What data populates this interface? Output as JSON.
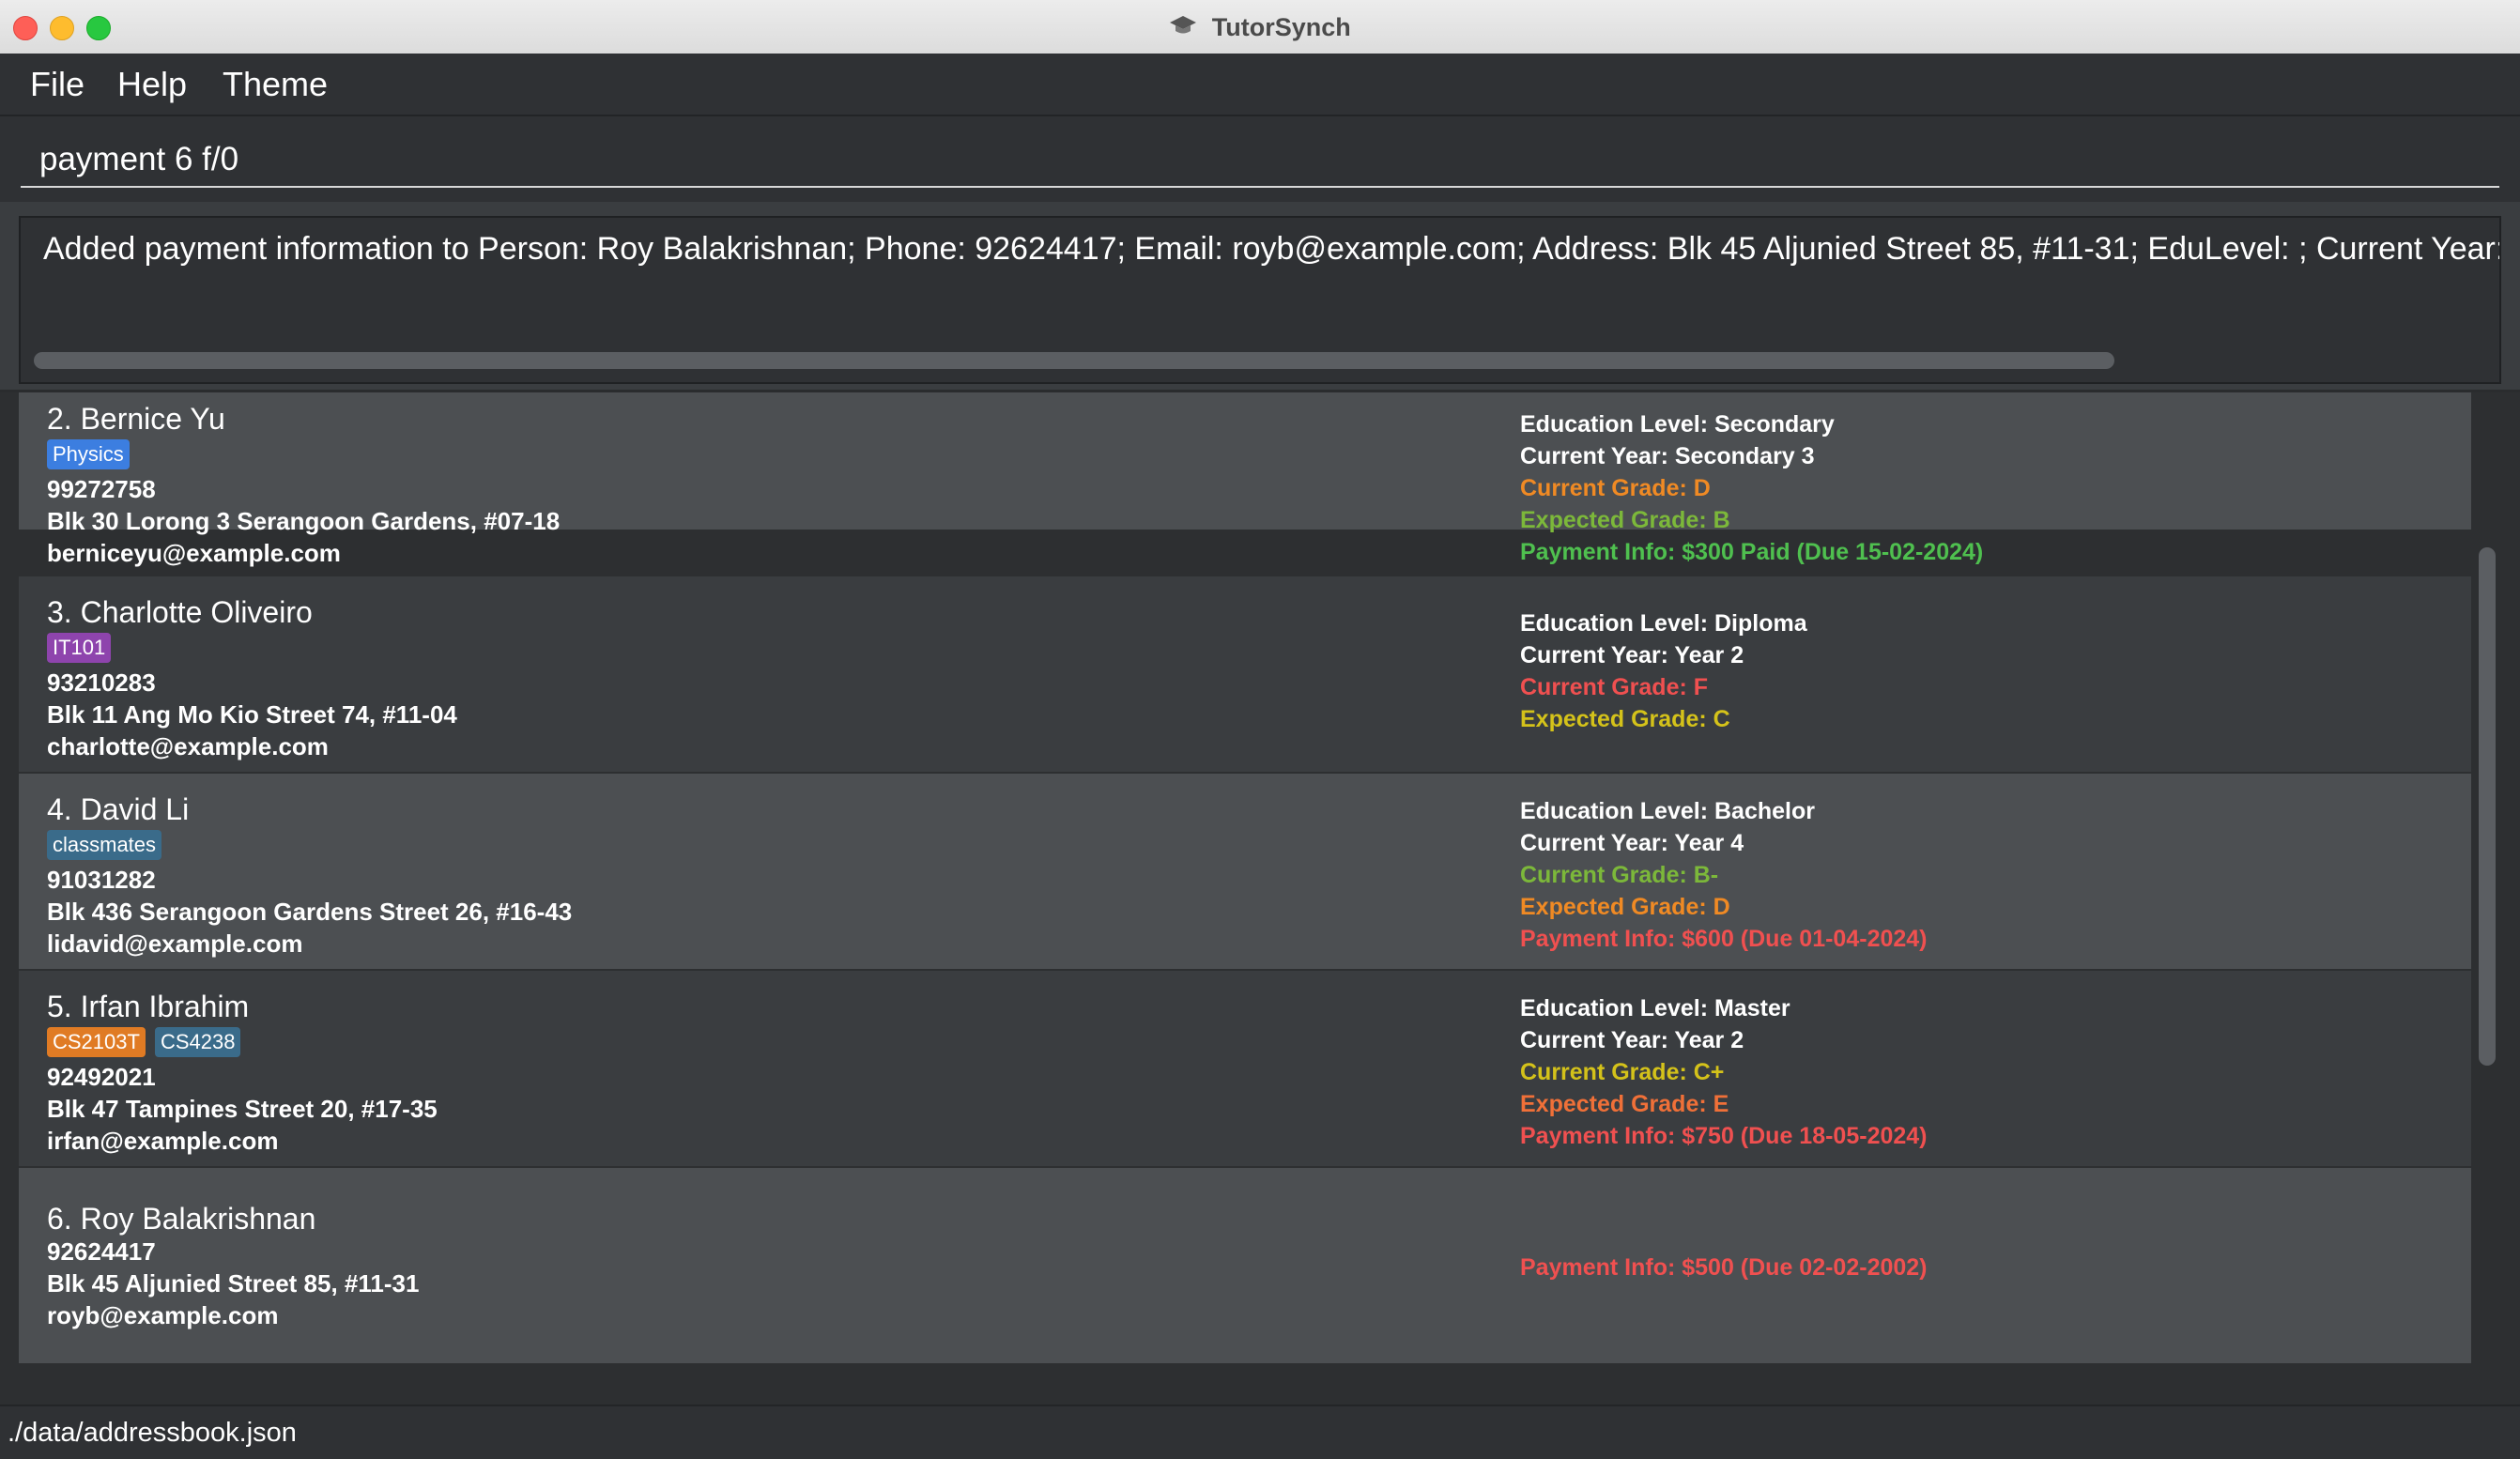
{
  "window": {
    "title": "TutorSynch"
  },
  "menu": {
    "file": "File",
    "help": "Help",
    "theme": "Theme"
  },
  "command": {
    "value": "payment 6 f/0"
  },
  "result": {
    "text": "Added payment information to Person: Roy Balakrishnan; Phone: 92624417; Email: royb@example.com; Address: Blk 45 Aljunied Street 85, #11-31; EduLevel: ; Current Year: ; Current"
  },
  "persons": [
    {
      "name": "2. Bernice Yu",
      "tags": [
        {
          "label": "Physics",
          "color": "#3c7ee0"
        }
      ],
      "phone": "99272758",
      "address": "Blk 30 Lorong 3 Serangoon Gardens, #07-18",
      "email": "berniceyu@example.com",
      "details": [
        {
          "text": "Education Level: Secondary",
          "color": "#ffffff"
        },
        {
          "text": "Current Year: Secondary 3",
          "color": "#ffffff"
        },
        {
          "text": "Current Grade: D",
          "color": "#f08a24"
        },
        {
          "text": "Expected Grade: B",
          "color": "#7cb83a"
        },
        {
          "text": "Payment Info: $300 Paid (Due 15-02-2024)",
          "color": "#4fc04f"
        }
      ]
    },
    {
      "name": "3. Charlotte Oliveiro",
      "tags": [
        {
          "label": "IT101",
          "color": "#8e44ad"
        }
      ],
      "phone": "93210283",
      "address": "Blk 11 Ang Mo Kio Street 74, #11-04",
      "email": "charlotte@example.com",
      "details": [
        {
          "text": "Education Level: Diploma",
          "color": "#ffffff"
        },
        {
          "text": "Current Year: Year 2",
          "color": "#ffffff"
        },
        {
          "text": "Current Grade: F",
          "color": "#f05050"
        },
        {
          "text": "Expected Grade: C",
          "color": "#d4c21a"
        }
      ]
    },
    {
      "name": "4. David Li",
      "tags": [
        {
          "label": "classmates",
          "color": "#3a6b8a"
        }
      ],
      "phone": "91031282",
      "address": "Blk 436 Serangoon Gardens Street 26, #16-43",
      "email": "lidavid@example.com",
      "details": [
        {
          "text": "Education Level: Bachelor",
          "color": "#ffffff"
        },
        {
          "text": "Current Year: Year 4",
          "color": "#ffffff"
        },
        {
          "text": "Current Grade: B-",
          "color": "#7cb83a"
        },
        {
          "text": "Expected Grade: D",
          "color": "#f08a24"
        },
        {
          "text": "Payment Info: $600 (Due 01-04-2024)",
          "color": "#f05050"
        }
      ]
    },
    {
      "name": "5. Irfan Ibrahim",
      "tags": [
        {
          "label": "CS2103T",
          "color": "#e07b24"
        },
        {
          "label": "CS4238",
          "color": "#3a6b8a"
        }
      ],
      "phone": "92492021",
      "address": "Blk 47 Tampines Street 20, #17-35",
      "email": "irfan@example.com",
      "details": [
        {
          "text": "Education Level: Master",
          "color": "#ffffff"
        },
        {
          "text": "Current Year: Year 2",
          "color": "#ffffff"
        },
        {
          "text": "Current Grade: C+",
          "color": "#d4c21a"
        },
        {
          "text": "Expected Grade: E",
          "color": "#f07038"
        },
        {
          "text": "Payment Info: $750 (Due 18-05-2024)",
          "color": "#f05050"
        }
      ]
    },
    {
      "name": "6. Roy Balakrishnan",
      "tags": [],
      "phone": "92624417",
      "address": "Blk 45 Aljunied Street 85, #11-31",
      "email": "royb@example.com",
      "details": [
        {
          "text": "Payment Info: $500 (Due 02-02-2002)",
          "color": "#f05050"
        }
      ]
    }
  ],
  "status": {
    "path": "./data/addressbook.json"
  }
}
